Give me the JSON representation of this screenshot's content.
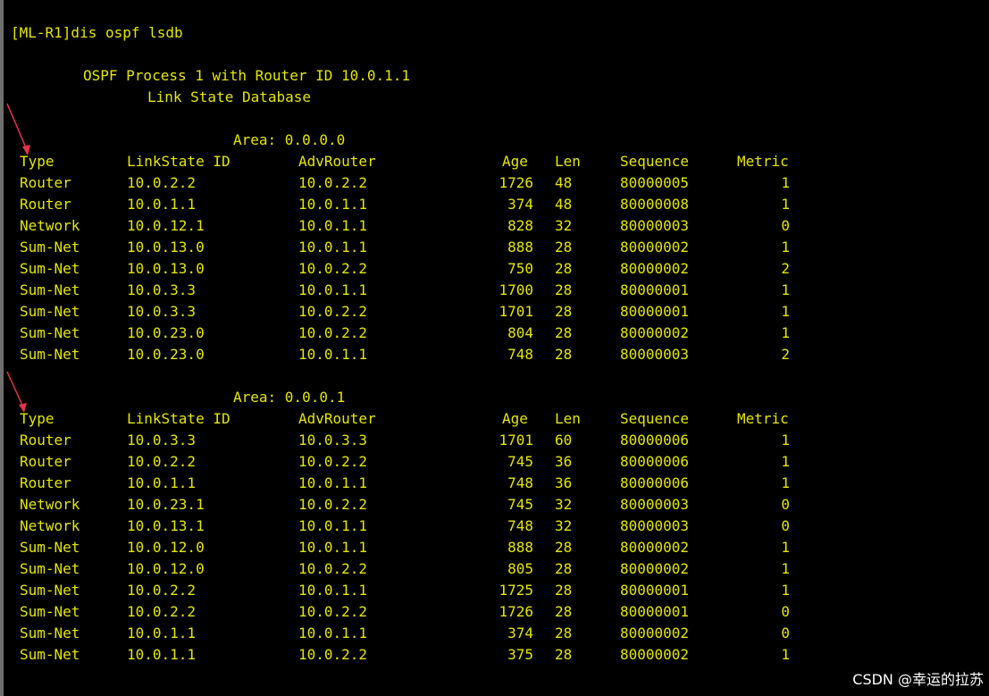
{
  "terminal": {
    "prompt_line": "[ML-R1]dis ospf lsdb",
    "process_line": "OSPF Process 1 with Router ID 10.0.1.1",
    "db_title": "Link State Database",
    "columns": [
      "Type",
      "LinkState ID",
      "AdvRouter",
      "Age",
      "Len",
      "Sequence",
      "Metric"
    ],
    "areas": [
      {
        "label": "Area: 0.0.0.0",
        "rows": [
          [
            "Router",
            "10.0.2.2",
            "10.0.2.2",
            "1726",
            "48",
            "80000005",
            "1"
          ],
          [
            "Router",
            "10.0.1.1",
            "10.0.1.1",
            "374",
            "48",
            "80000008",
            "1"
          ],
          [
            "Network",
            "10.0.12.1",
            "10.0.1.1",
            "828",
            "32",
            "80000003",
            "0"
          ],
          [
            "Sum-Net",
            "10.0.13.0",
            "10.0.1.1",
            "888",
            "28",
            "80000002",
            "1"
          ],
          [
            "Sum-Net",
            "10.0.13.0",
            "10.0.2.2",
            "750",
            "28",
            "80000002",
            "2"
          ],
          [
            "Sum-Net",
            "10.0.3.3",
            "10.0.1.1",
            "1700",
            "28",
            "80000001",
            "1"
          ],
          [
            "Sum-Net",
            "10.0.3.3",
            "10.0.2.2",
            "1701",
            "28",
            "80000001",
            "1"
          ],
          [
            "Sum-Net",
            "10.0.23.0",
            "10.0.2.2",
            "804",
            "28",
            "80000002",
            "1"
          ],
          [
            "Sum-Net",
            "10.0.23.0",
            "10.0.1.1",
            "748",
            "28",
            "80000003",
            "2"
          ]
        ]
      },
      {
        "label": "Area: 0.0.0.1",
        "rows": [
          [
            "Router",
            "10.0.3.3",
            "10.0.3.3",
            "1701",
            "60",
            "80000006",
            "1"
          ],
          [
            "Router",
            "10.0.2.2",
            "10.0.2.2",
            "745",
            "36",
            "80000006",
            "1"
          ],
          [
            "Router",
            "10.0.1.1",
            "10.0.1.1",
            "748",
            "36",
            "80000006",
            "1"
          ],
          [
            "Network",
            "10.0.23.1",
            "10.0.2.2",
            "745",
            "32",
            "80000003",
            "0"
          ],
          [
            "Network",
            "10.0.13.1",
            "10.0.1.1",
            "748",
            "32",
            "80000003",
            "0"
          ],
          [
            "Sum-Net",
            "10.0.12.0",
            "10.0.1.1",
            "888",
            "28",
            "80000002",
            "1"
          ],
          [
            "Sum-Net",
            "10.0.12.0",
            "10.0.2.2",
            "805",
            "28",
            "80000002",
            "1"
          ],
          [
            "Sum-Net",
            "10.0.2.2",
            "10.0.1.1",
            "1725",
            "28",
            "80000001",
            "1"
          ],
          [
            "Sum-Net",
            "10.0.2.2",
            "10.0.2.2",
            "1726",
            "28",
            "80000001",
            "0"
          ],
          [
            "Sum-Net",
            "10.0.1.1",
            "10.0.1.1",
            "374",
            "28",
            "80000002",
            "0"
          ],
          [
            "Sum-Net",
            "10.0.1.1",
            "10.0.2.2",
            "375",
            "28",
            "80000002",
            "1"
          ]
        ]
      }
    ]
  },
  "watermark": "CSDN @幸运的拉苏",
  "colors": {
    "terminal_bg": "#000000",
    "terminal_text": "#e6e600",
    "annotation_arrow": "#e8334a"
  }
}
